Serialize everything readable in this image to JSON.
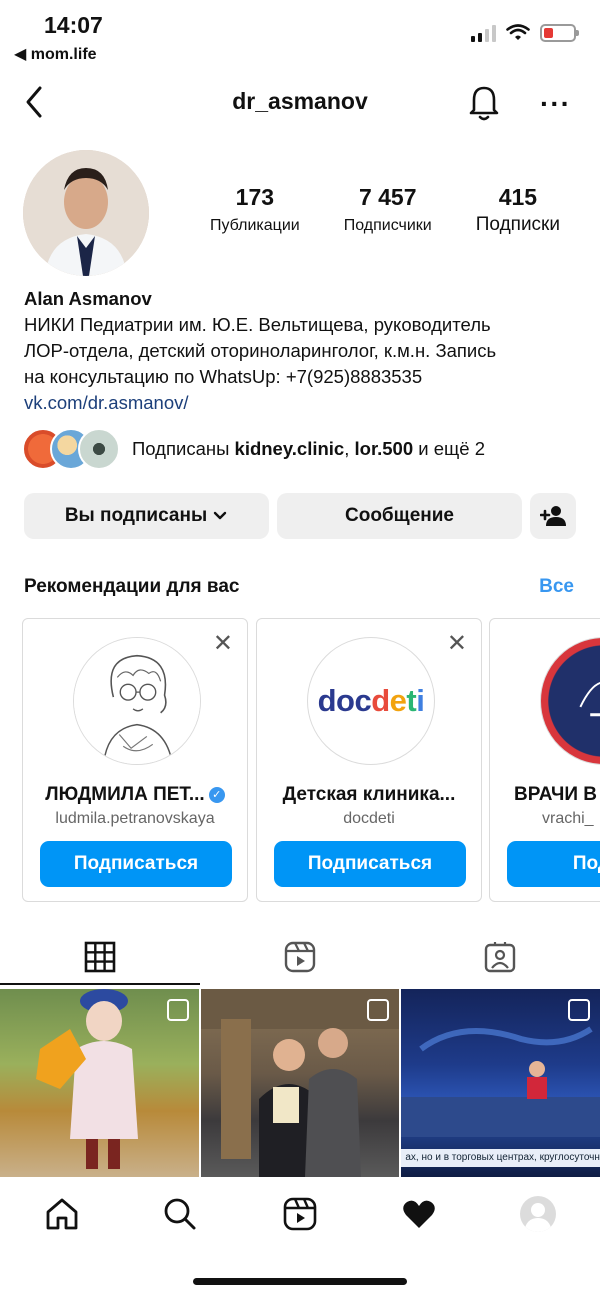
{
  "status_bar": {
    "time": "14:07",
    "back_app": "◀ mom.life"
  },
  "header": {
    "username": "dr_asmanov"
  },
  "profile": {
    "stats": [
      {
        "value": "173",
        "label": "Публикации"
      },
      {
        "value": "7 457",
        "label": "Подписчики"
      },
      {
        "value": "415",
        "label": "Подписки"
      }
    ],
    "name": "Alan Asmanov",
    "bio_lines": [
      "НИКИ Педиатрии им. Ю.Е. Вельтищева, руководитель",
      "ЛОР-отдела, детский оториноларинголог, к.м.н. Запись",
      "на консультацию по WhatsUp: +7(925)8883535"
    ],
    "link": "vk.com/dr.asmanov/",
    "mutual": {
      "prefix": "Подписаны ",
      "user1": "kidney.clinic",
      "sep": ", ",
      "user2": "lor.500",
      "suffix": " и ещё 2"
    }
  },
  "actions": {
    "following_label": "Вы подписаны",
    "message_label": "Сообщение"
  },
  "recommendations": {
    "title": "Рекомендации для вас",
    "see_all": "Все",
    "cards": [
      {
        "name": "ЛЮДМИЛА ПЕТ...",
        "handle": "ludmila.petranovskaya",
        "button": "Подписаться"
      },
      {
        "name": "Детская клиника...",
        "handle": "docdeti",
        "button": "Подписаться",
        "logo": "docdeti"
      },
      {
        "name": "ВРАЧИ В",
        "handle": "vrachi_",
        "button": "Подпи"
      }
    ]
  },
  "grid": {
    "ticker": "ах, но и в торговых центрах, круглосуточных пунктах вакц"
  },
  "colors": {
    "accent": "#0095f6",
    "link": "#1c3f7a",
    "see_all": "#3897f0"
  }
}
